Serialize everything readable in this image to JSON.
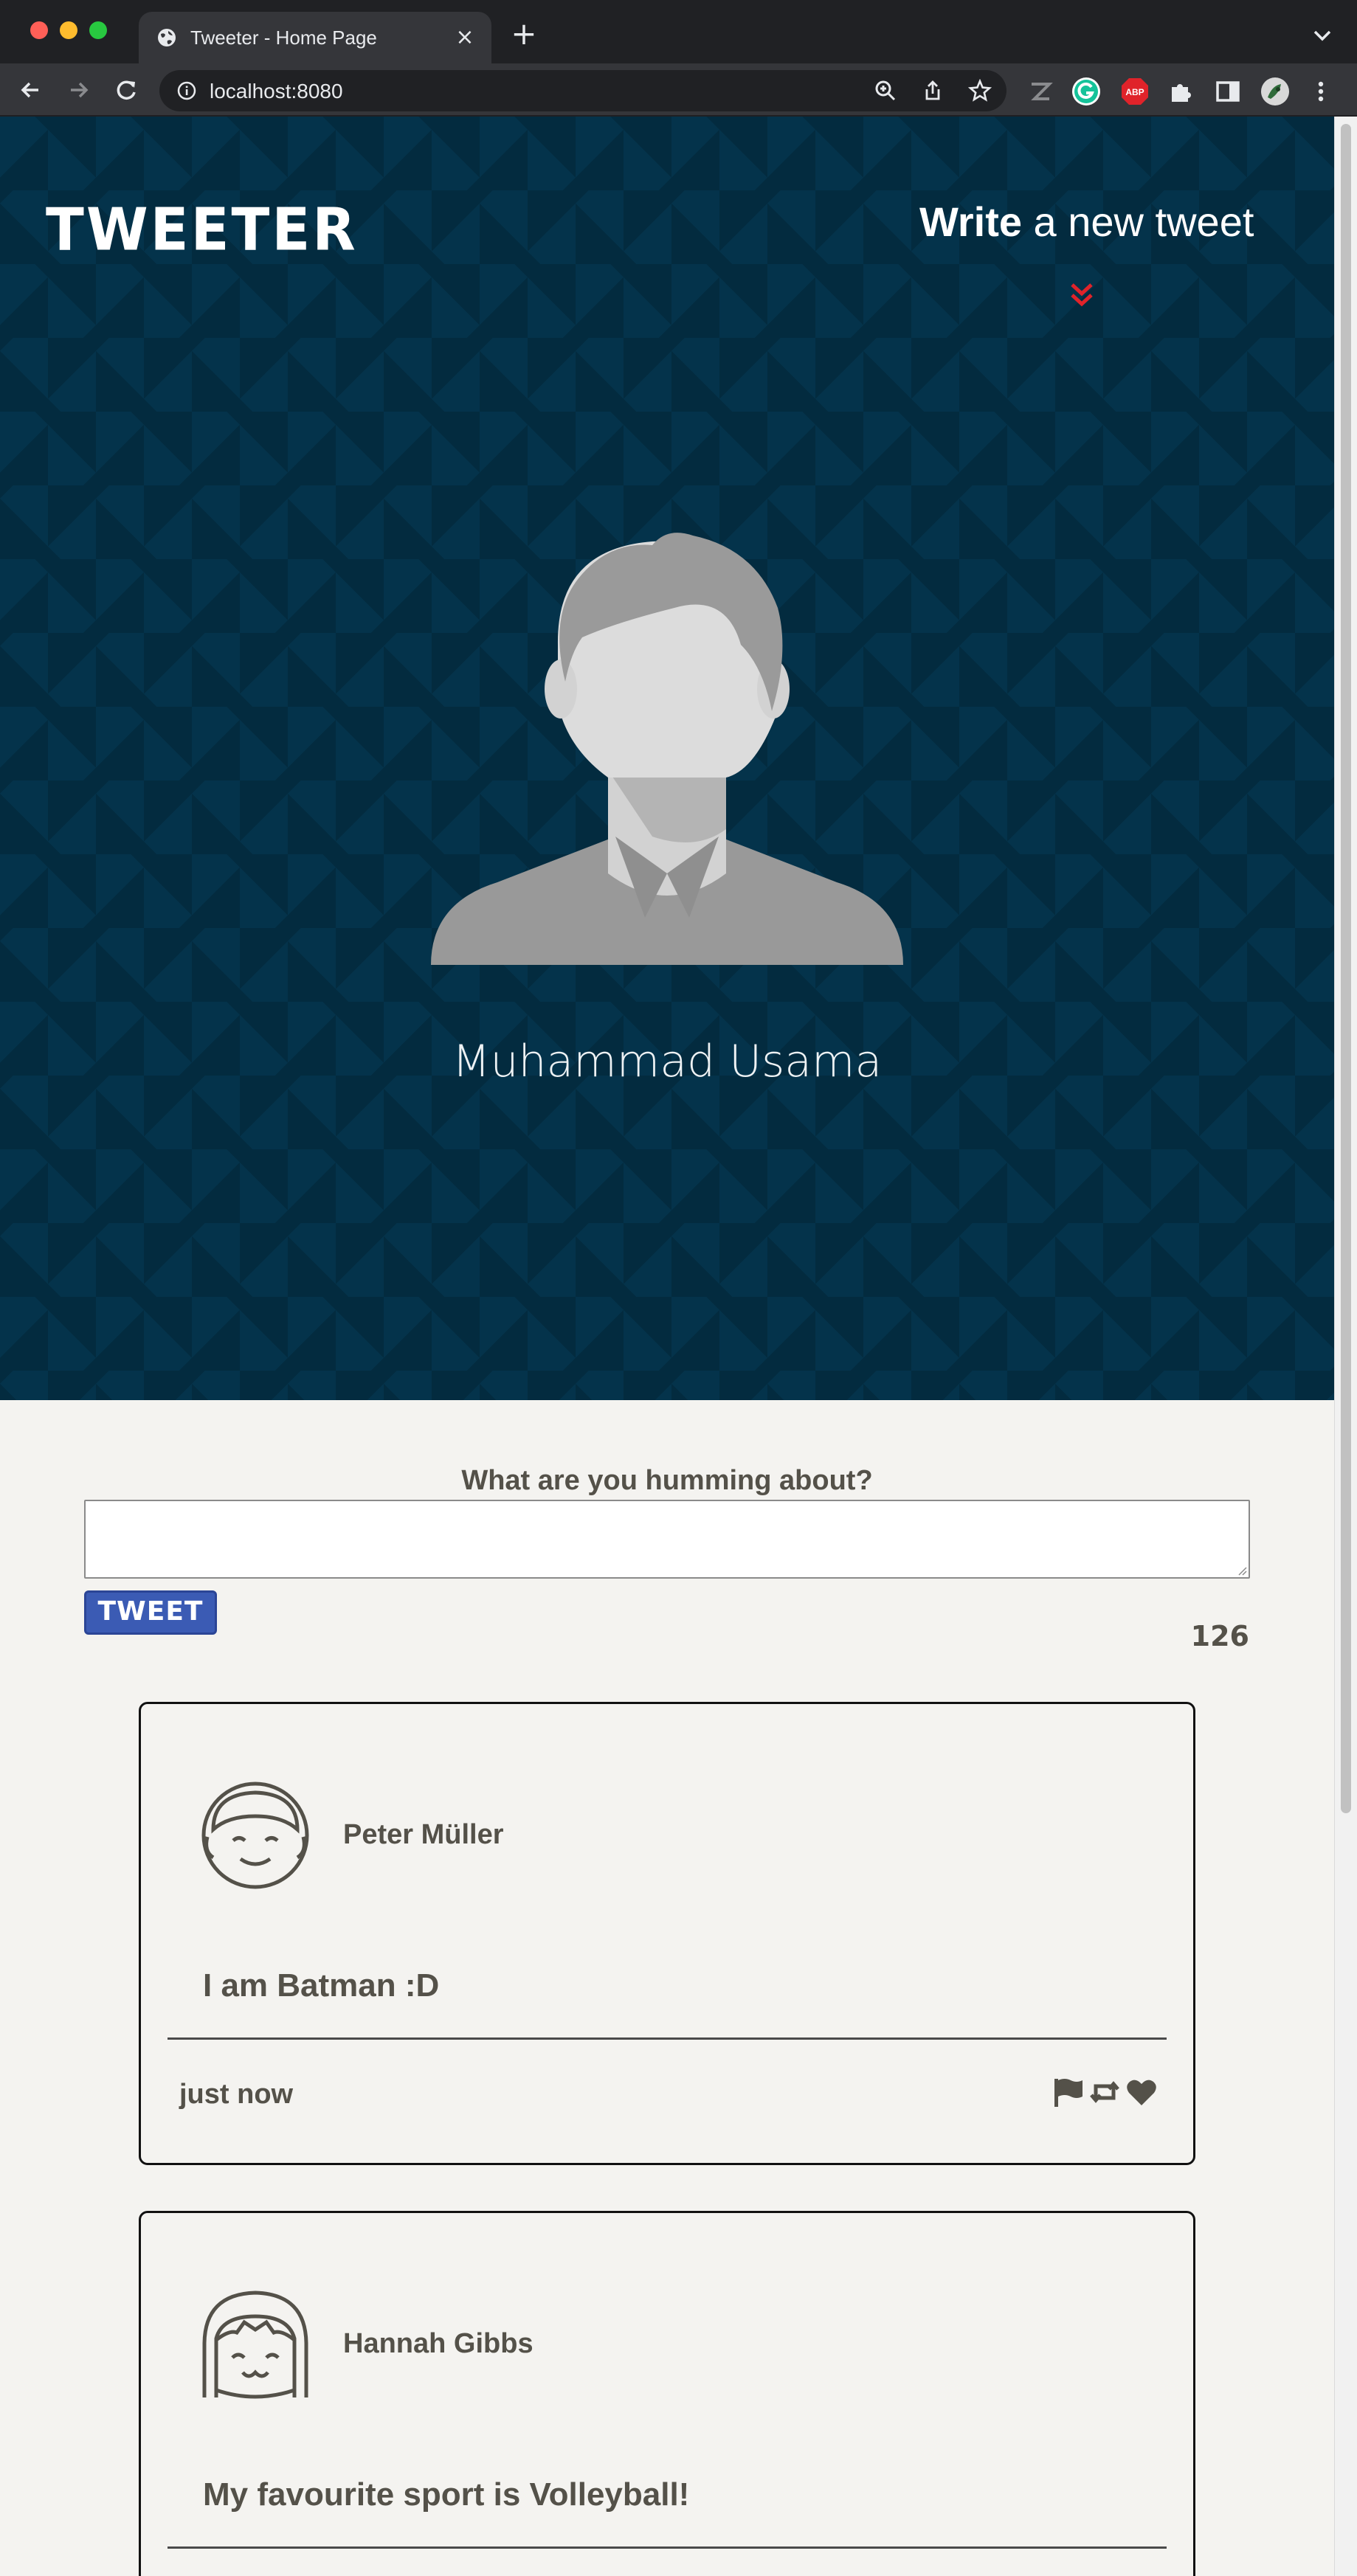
{
  "browser": {
    "tab_title": "Tweeter - Home Page",
    "url": "localhost:8080"
  },
  "header": {
    "logo": "TWEETER",
    "write_bold": "Write",
    "write_rest": " a new tweet"
  },
  "profile": {
    "name": "Muhammad Usama"
  },
  "compose": {
    "label": "What are you humming about?",
    "placeholder": "",
    "button_label": "TWEET",
    "char_counter": "126"
  },
  "tweets": [
    {
      "user": "Peter Müller",
      "text": "I am Batman :D",
      "time": "just now",
      "avatar_icon": "smiling-boy-avatar-icon"
    },
    {
      "user": "Hannah Gibbs",
      "text": "My favourite sport is Volleyball!",
      "time": "",
      "avatar_icon": "smiling-girl-avatar-icon"
    }
  ],
  "icons": {
    "flag": "flag-icon",
    "retweet": "retweet-icon",
    "like": "heart-icon"
  },
  "colors": {
    "hero_bg": "#04334b",
    "accent_red": "#e0232a",
    "button_blue": "#3b5bb4",
    "text_gray": "#545149",
    "page_bg": "#f4f3f0"
  }
}
